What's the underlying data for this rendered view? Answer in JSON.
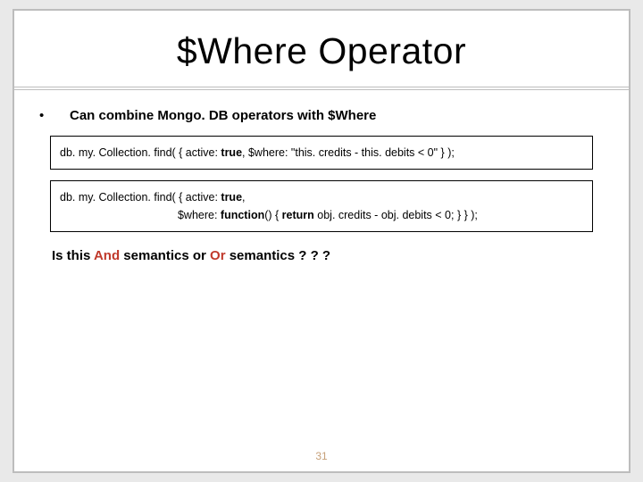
{
  "title": "$Where Operator",
  "bullet": {
    "dot": "•",
    "text": "Can combine Mongo. DB operators  with  $Where"
  },
  "code1": {
    "pre": "db. my. Collection. find( { active: ",
    "kw1": "true",
    "mid": ", $where: \"this. credits - this. debits < 0\" } );"
  },
  "code2": {
    "line1pre": "db. my. Collection. find( { active: ",
    "line1kw": "true",
    "line1post": ",",
    "indent": "                                      $where: ",
    "kw2": "function",
    "mid2": "() { ",
    "kw3": "return",
    "post": " obj. credits - obj. debits < 0; } } );"
  },
  "question": {
    "p1": "Is this ",
    "and": "And",
    "p2": " semantics or  ",
    "or": "Or",
    "p3": " semantics ? ? ?"
  },
  "page": "31"
}
